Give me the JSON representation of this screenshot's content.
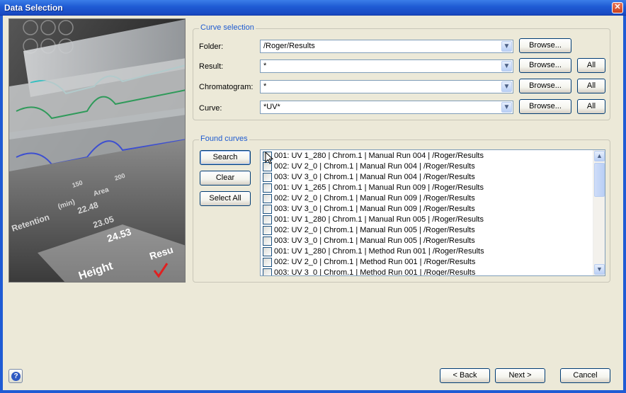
{
  "window": {
    "title": "Data Selection"
  },
  "curve_selection": {
    "title": "Curve selection",
    "folder": {
      "label": "Folder:",
      "value": "/Roger/Results",
      "browse": "Browse..."
    },
    "result": {
      "label": "Result:",
      "value": "*",
      "browse": "Browse...",
      "all": "All"
    },
    "chromatogram": {
      "label": "Chromatogram:",
      "value": "*",
      "browse": "Browse...",
      "all": "All"
    },
    "curve": {
      "label": "Curve:",
      "value": "*UV*",
      "browse": "Browse...",
      "all": "All"
    }
  },
  "found_curves": {
    "title": "Found curves",
    "buttons": {
      "search": "Search",
      "clear": "Clear",
      "select_all": "Select All"
    },
    "items": [
      "001: UV 1_280 | Chrom.1 | Manual Run  004 | /Roger/Results",
      "002: UV 2_0 | Chrom.1 | Manual Run  004 | /Roger/Results",
      "003: UV 3_0 | Chrom.1 | Manual Run  004 | /Roger/Results",
      "001: UV 1_265 | Chrom.1 | Manual Run  009 | /Roger/Results",
      "002: UV 2_0 | Chrom.1 | Manual Run  009 | /Roger/Results",
      "003: UV 3_0 | Chrom.1 | Manual Run  009 | /Roger/Results",
      "001: UV 1_280 | Chrom.1 | Manual Run  005 | /Roger/Results",
      "002: UV 2_0 | Chrom.1 | Manual Run  005 | /Roger/Results",
      "003: UV 3_0 | Chrom.1 | Manual Run  005 | /Roger/Results",
      "001: UV 1_280 | Chrom.1 | Method Run  001 | /Roger/Results",
      "002: UV 2_0 | Chrom.1 | Method Run  001 | /Roger/Results",
      "003: UV 3_0 | Chrom.1 | Method Run  001 | /Roger/Results"
    ]
  },
  "hero_image": {
    "texts": [
      "Retention",
      "(min)",
      "Area",
      "Height",
      "Resu",
      "22.48",
      "23.05",
      "24.53",
      "150",
      "200"
    ]
  },
  "footer": {
    "back": "< Back",
    "next": "Next >",
    "cancel": "Cancel"
  },
  "colors": {
    "title_bar": "#1f5bd4",
    "group_title": "#1e5bd0",
    "dialog_bg": "#ece9d8"
  },
  "icons": [
    "close-icon",
    "help-icon",
    "dropdown-arrow-icon",
    "scroll-up-icon",
    "scroll-down-icon",
    "mouse-cursor-icon"
  ]
}
